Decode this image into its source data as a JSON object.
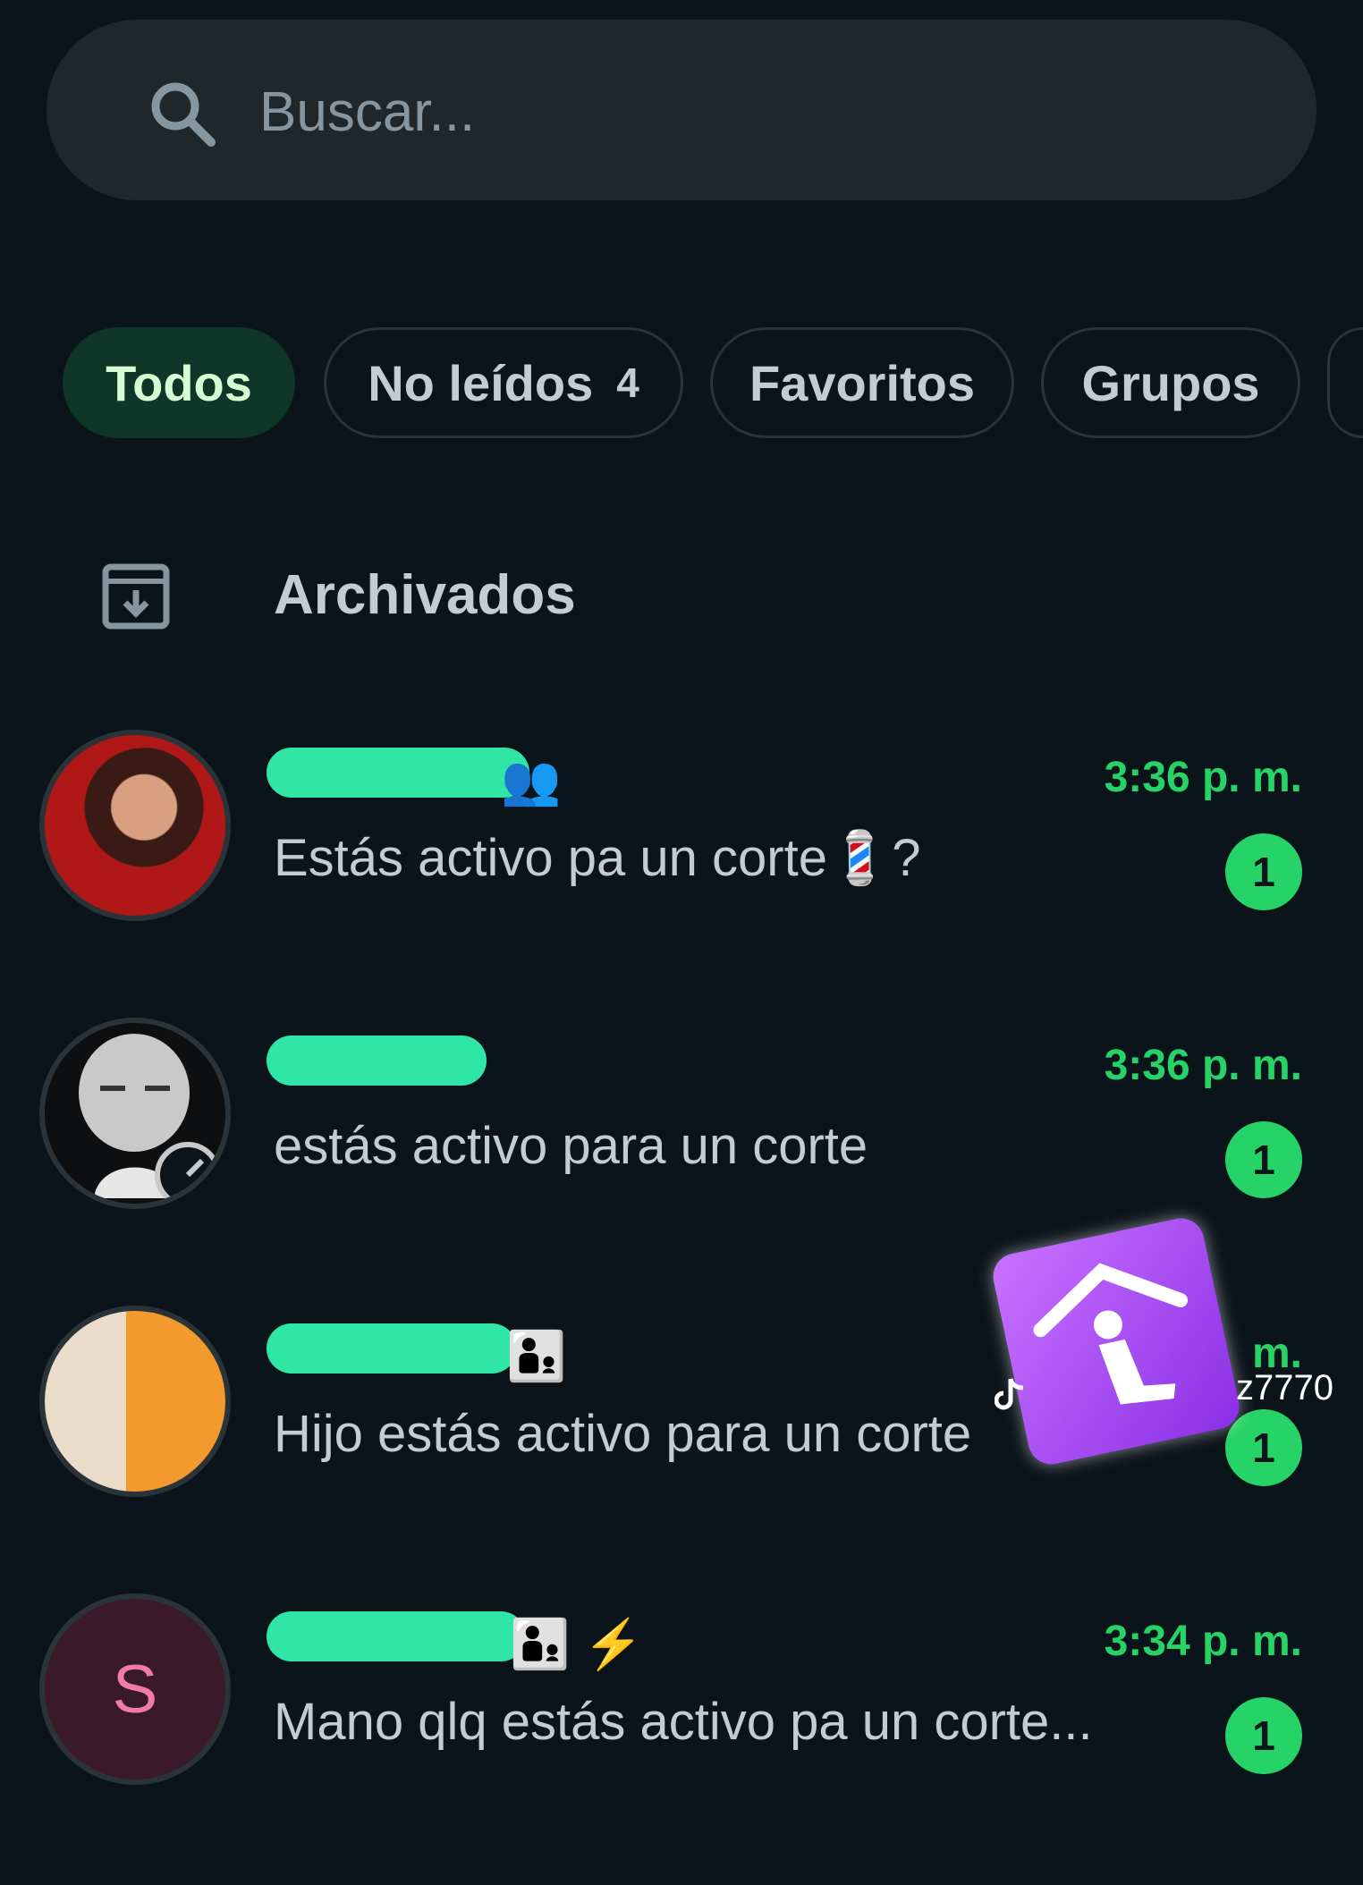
{
  "search": {
    "placeholder": "Buscar..."
  },
  "filters": [
    {
      "label": "Todos",
      "active": true
    },
    {
      "label": "No leídos",
      "count": "4"
    },
    {
      "label": "Favoritos"
    },
    {
      "label": "Grupos"
    }
  ],
  "archived": {
    "label": "Archivados"
  },
  "chats": [
    {
      "name_suffix": "👥",
      "time": "3:36 p. m.",
      "message": "Estás activo pa un corte💈?",
      "unread": "1"
    },
    {
      "name_suffix": "",
      "time": "3:36 p. m.",
      "message": "estás activo para un corte",
      "unread": "1"
    },
    {
      "name_suffix": "👨‍👦",
      "time": "m.",
      "message": "Hijo estás activo para un corte",
      "unread": "1"
    },
    {
      "name_suffix": "👨‍👦 ⚡",
      "avatar_letter": "S",
      "time": "3:34 p. m.",
      "message": "Mano qlq estás activo pa un corte...",
      "unread": "1"
    }
  ],
  "watermark": {
    "text": "z7770"
  },
  "colors": {
    "accent": "#25d366",
    "background": "#0b141a",
    "chip_active": "#103529"
  }
}
